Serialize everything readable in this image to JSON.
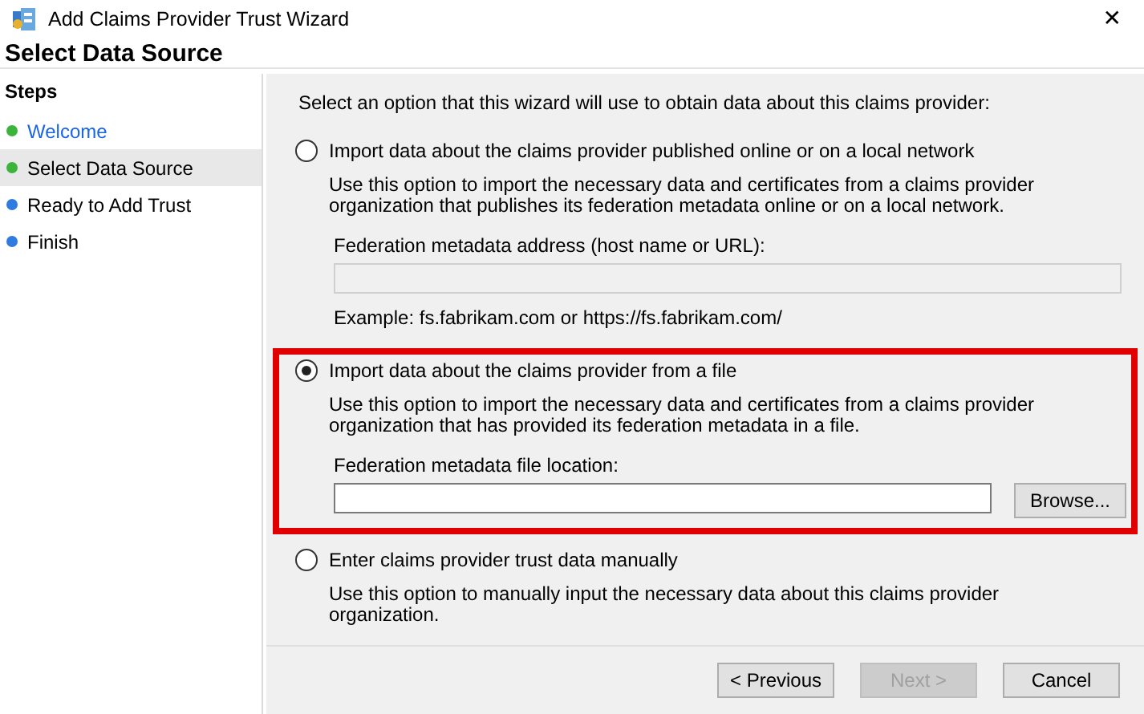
{
  "window": {
    "title": "Add Claims Provider Trust Wizard",
    "close": "✕"
  },
  "header": {
    "title": "Select Data Source"
  },
  "sidebar": {
    "title": "Steps",
    "items": [
      {
        "label": "Welcome",
        "kind": "link",
        "color": "#3cb43c",
        "selected": false
      },
      {
        "label": "Select Data Source",
        "kind": "text",
        "color": "#3cb43c",
        "selected": true
      },
      {
        "label": "Ready to Add Trust",
        "kind": "text",
        "color": "#2f7be0",
        "selected": false
      },
      {
        "label": "Finish",
        "kind": "text",
        "color": "#2f7be0",
        "selected": false
      }
    ]
  },
  "content": {
    "intro": "Select an option that this wizard will use to obtain data about this claims provider:",
    "options": [
      {
        "label": "Import data about the claims provider published online or on a local network",
        "selected": false,
        "highlighted": false,
        "description": "Use this option to import the necessary data and certificates from a claims provider organization that publishes its federation metadata online or on a local network.",
        "field": {
          "label": "Federation metadata address (host name or URL):",
          "disabled": true,
          "example": "Example: fs.fabrikam.com or https://fs.fabrikam.com/"
        }
      },
      {
        "label": "Import data about the claims provider from a file",
        "selected": true,
        "highlighted": true,
        "description": "Use this option to import the necessary data and certificates from a claims provider organization that has provided its federation metadata in a file.",
        "field": {
          "label": "Federation metadata file location:",
          "disabled": false,
          "button": "Browse..."
        }
      },
      {
        "label": "Enter claims provider trust data manually",
        "selected": false,
        "highlighted": false,
        "description": "Use this option to manually input the necessary data about this claims provider organization."
      }
    ]
  },
  "buttons": [
    {
      "label": "< Previous",
      "disabled": false
    },
    {
      "label": "Next >",
      "disabled": true
    },
    {
      "label": "Cancel",
      "disabled": false
    }
  ]
}
